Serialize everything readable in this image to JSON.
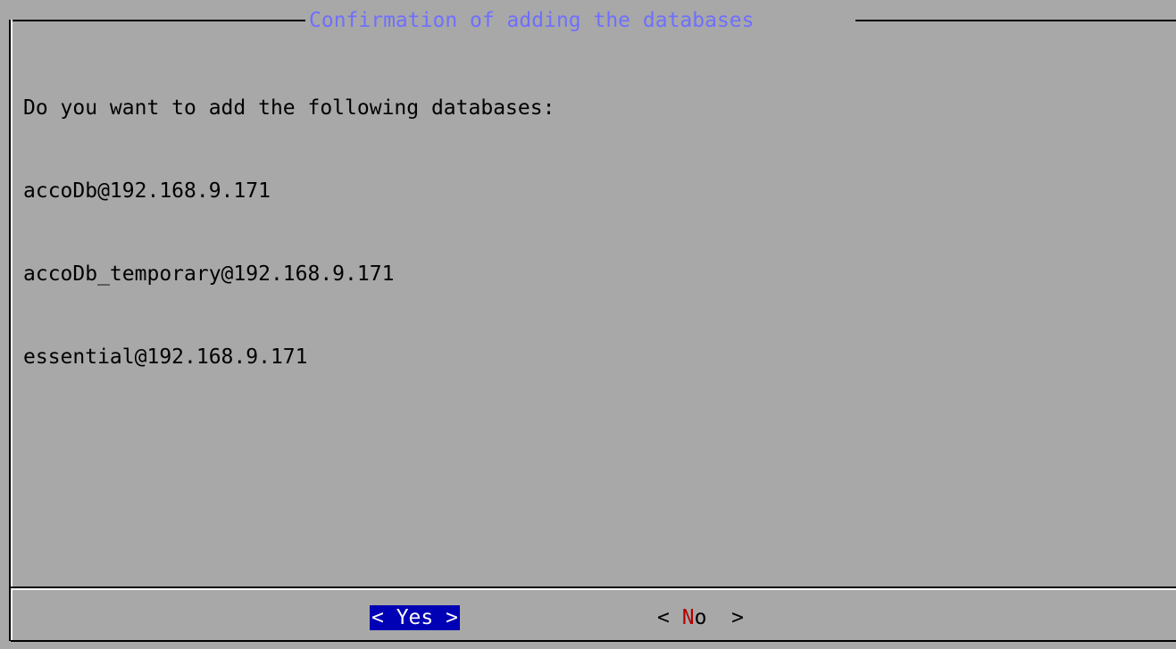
{
  "dialog": {
    "title": "Confirmation of adding the databases",
    "message_lines": [
      "Do you want to add the following databases:",
      "accoDb@192.168.9.171",
      "accoDb_temporary@192.168.9.171",
      "essential@192.168.9.171"
    ]
  },
  "buttons": {
    "yes": {
      "open": "< ",
      "label": "Yes",
      "close": " >"
    },
    "no": {
      "open": "< ",
      "hotkey": "N",
      "rest": "o",
      "close": "  >"
    }
  },
  "colors": {
    "background": "#a8a8a8",
    "title": "#6f6fff",
    "selected_button_bg": "#0000b4",
    "selected_button_fg": "#ffffff",
    "hotkey": "#b40000"
  }
}
